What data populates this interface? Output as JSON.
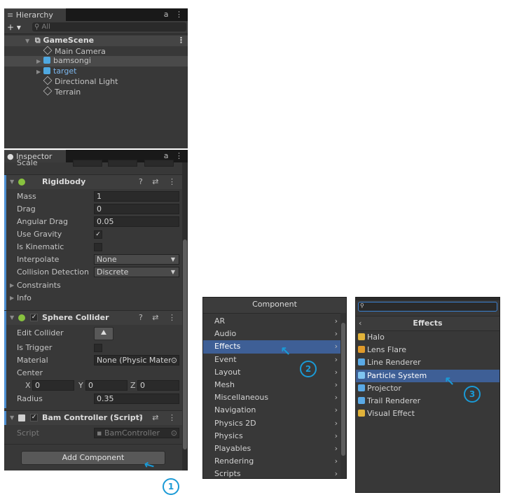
{
  "hierarchy": {
    "tab_label": "Hierarchy",
    "tab_icons": "⋮",
    "add_label": "+ ▾",
    "search_placeholder": "All",
    "scene": "GameScene",
    "items": [
      {
        "label": "Main Camera",
        "icon": "cube-icon"
      },
      {
        "label": "bamsongi",
        "icon": "prefab-icon"
      },
      {
        "label": "target",
        "icon": "prefab-icon"
      },
      {
        "label": "Directional Light",
        "icon": "cube-icon"
      },
      {
        "label": "Terrain",
        "icon": "cube-icon"
      }
    ]
  },
  "inspector": {
    "tab_label": "Inspector",
    "scale_label": "Scale",
    "rigidbody": {
      "title": "Rigidbody",
      "mass_label": "Mass",
      "mass": "1",
      "drag_label": "Drag",
      "drag": "0",
      "angular_drag_label": "Angular Drag",
      "angular_drag": "0.05",
      "use_gravity_label": "Use Gravity",
      "is_kinematic_label": "Is Kinematic",
      "interpolate_label": "Interpolate",
      "interpolate": "None",
      "collision_label": "Collision Detection",
      "collision": "Discrete",
      "constraints_label": "Constraints",
      "info_label": "Info"
    },
    "sphere": {
      "title": "Sphere Collider",
      "edit_label": "Edit Collider",
      "trigger_label": "Is Trigger",
      "material_label": "Material",
      "material": "None (Physic Mater",
      "center_label": "Center",
      "x": "0",
      "y": "0",
      "z": "0",
      "radius_label": "Radius",
      "radius": "0.35"
    },
    "bam": {
      "title": "Bam Controller (Script)",
      "script_label": "Script",
      "script": "BamController"
    },
    "add_component": "Add Component"
  },
  "component_menu": {
    "title": "Component",
    "items": [
      "AR",
      "Audio",
      "Effects",
      "Event",
      "Layout",
      "Mesh",
      "Miscellaneous",
      "Navigation",
      "Physics 2D",
      "Physics",
      "Playables",
      "Rendering",
      "Scripts"
    ],
    "highlighted": "Effects"
  },
  "effects_menu": {
    "title": "Effects",
    "items": [
      {
        "label": "Halo",
        "color": "#e0b23a"
      },
      {
        "label": "Lens Flare",
        "color": "#e09a2a"
      },
      {
        "label": "Line Renderer",
        "color": "#5aa9e6"
      },
      {
        "label": "Particle System",
        "color": "#7fc4f0"
      },
      {
        "label": "Projector",
        "color": "#5aa9e6"
      },
      {
        "label": "Trail Renderer",
        "color": "#5aa9e6"
      },
      {
        "label": "Visual Effect",
        "color": "#e0b23a"
      }
    ],
    "highlighted": "Particle System"
  },
  "annotations": {
    "one": "1",
    "two": "2",
    "three": "3"
  },
  "colors": {
    "panel": "#383838",
    "highlight": "#3e5f96",
    "accent": "#4d8fd1",
    "annotation": "#1a9ad6"
  }
}
